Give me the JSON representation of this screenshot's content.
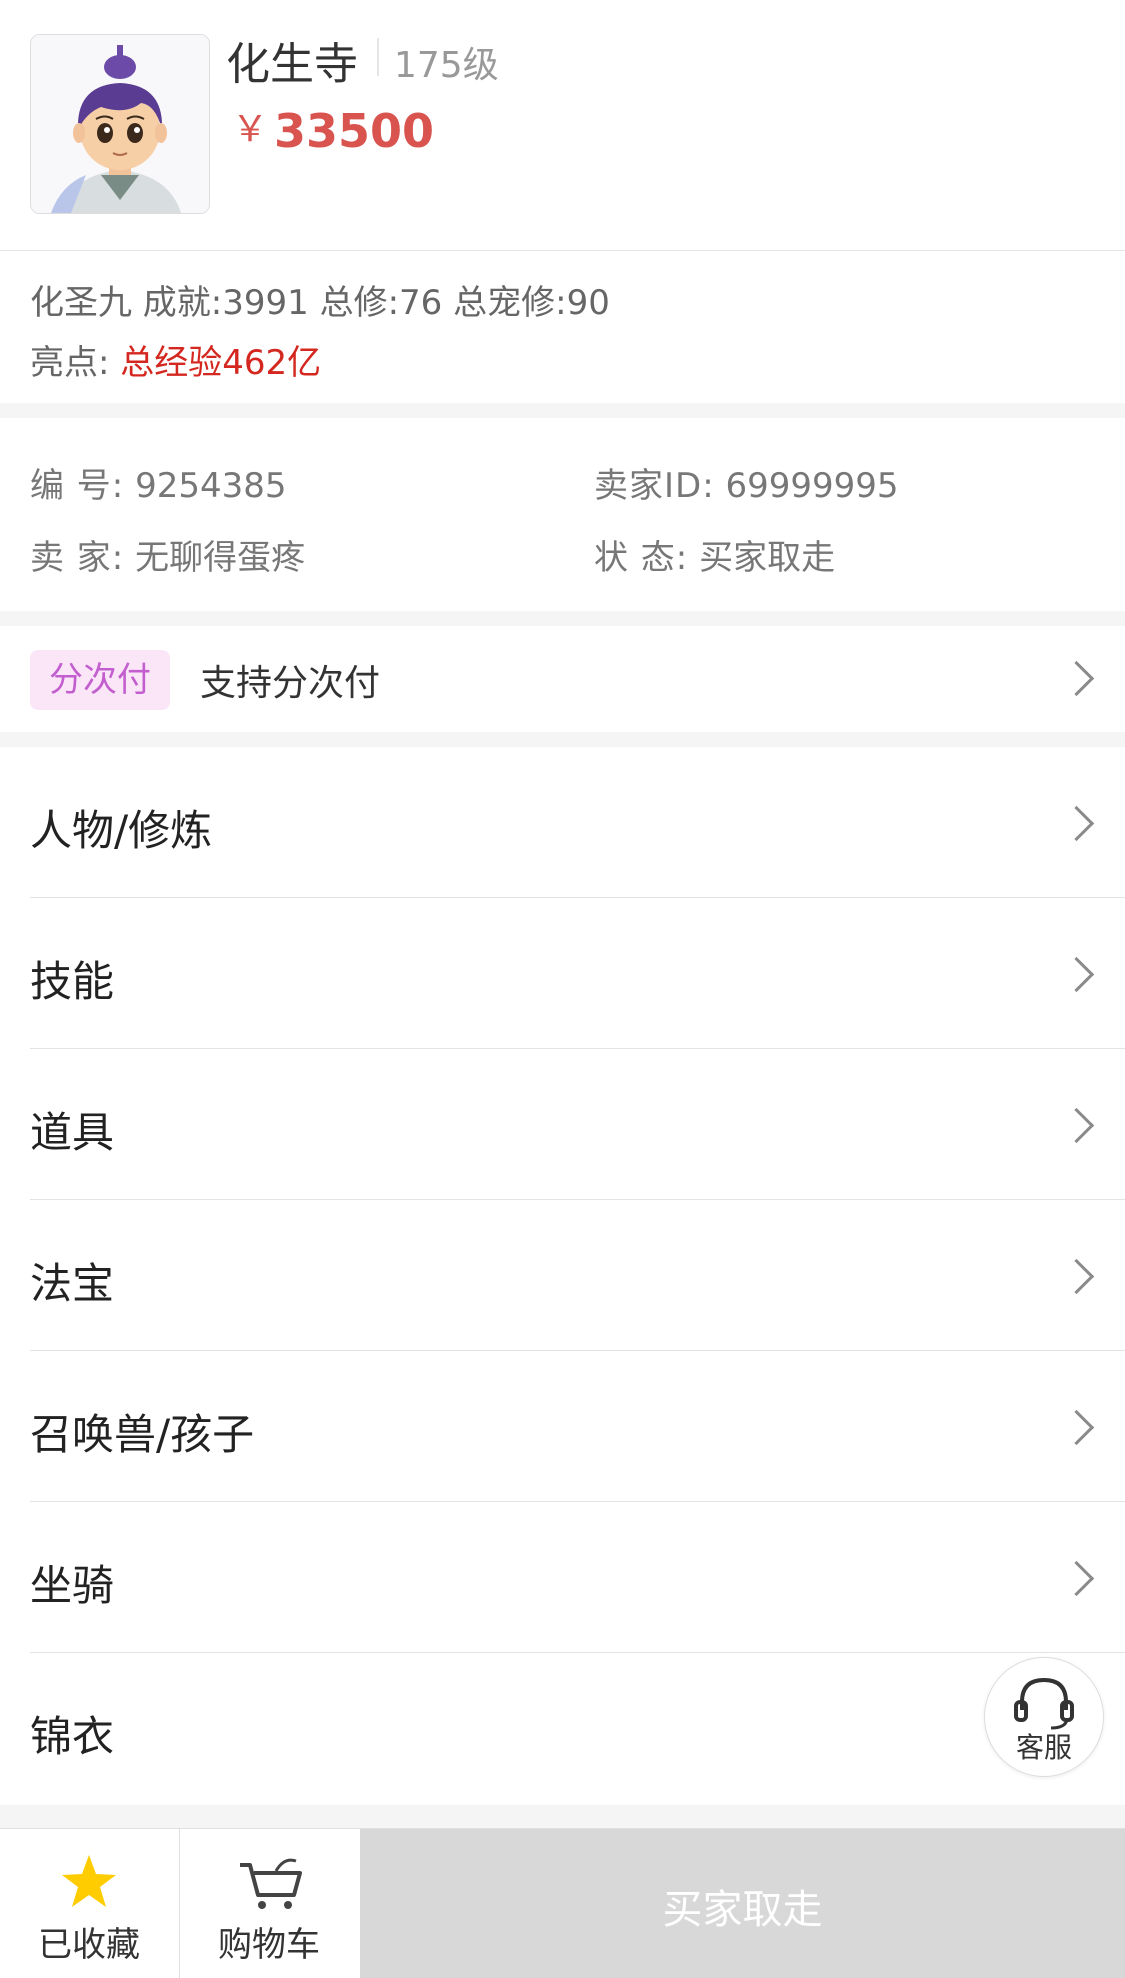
{
  "header": {
    "title": "化生寺",
    "level": "175级",
    "currency": "￥",
    "price": "33500"
  },
  "info": {
    "stats": "化圣九 成就:3991 总修:76 总宠修:90",
    "highlight_label": "亮点:",
    "highlight_value": "总经验462亿"
  },
  "detail": {
    "id_label": "编 号:",
    "id_value": "9254385",
    "seller_id_label": "卖家ID:",
    "seller_id_value": "69999995",
    "seller_label": "卖 家:",
    "seller_value": "无聊得蛋疼",
    "status_label": "状 态:",
    "status_value": "买家取走"
  },
  "installment": {
    "tag": "分次付",
    "text": "支持分次付"
  },
  "menu": {
    "items": [
      {
        "label": "人物/修炼"
      },
      {
        "label": "技能"
      },
      {
        "label": "道具"
      },
      {
        "label": "法宝"
      },
      {
        "label": "召唤兽/孩子"
      },
      {
        "label": "坐骑"
      },
      {
        "label": "锦衣"
      }
    ]
  },
  "service": {
    "label": "客服",
    "icon": "headset-icon"
  },
  "bottom_bar": {
    "favorite_label": "已收藏",
    "favorite_icon": "star-icon",
    "favorite_color": "#ffcc00",
    "cart_label": "购物车",
    "cart_icon": "cart-icon",
    "buy_label": "买家取走"
  },
  "colors": {
    "price": "#d9534f",
    "highlight": "#d4271f",
    "tag_bg": "#fbe6f8",
    "tag_text": "#c35ecf",
    "disabled_button": "#d8d8d8"
  }
}
